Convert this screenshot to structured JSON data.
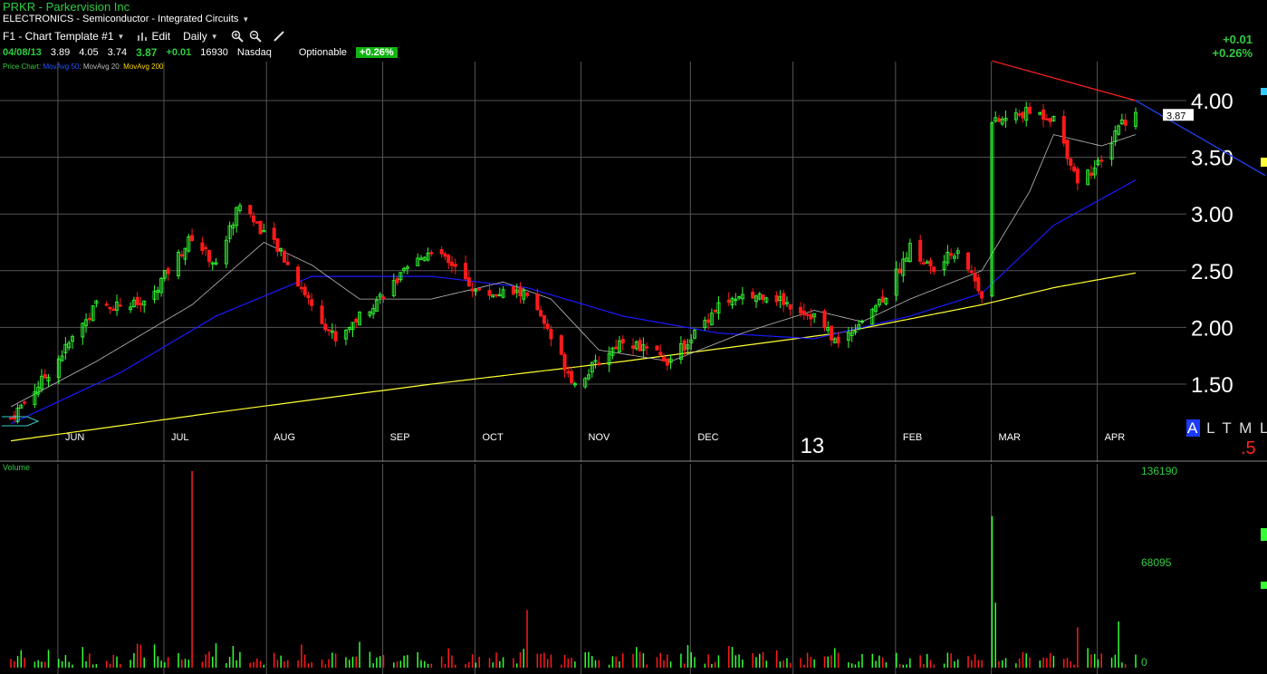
{
  "header": {
    "title": "PRKR - Parkervision Inc",
    "sector": "ELECTRONICS - Semiconductor - Integrated Circuits"
  },
  "toolbar": {
    "template": "F1 - Chart Template #1",
    "edit": "Edit",
    "period": "Daily"
  },
  "quote": {
    "date": "04/08/13",
    "open": "3.89",
    "high": "4.05",
    "low": "3.74",
    "last": "3.87",
    "change": "+0.01",
    "volume": "16930",
    "exchange": "Nasdaq",
    "optionable": "Optionable",
    "pct_change": "+0.26%"
  },
  "legend": {
    "price_chart": "Price Chart",
    "ma50": "MovAvg 50",
    "ma20": "MovAvg 20",
    "ma200": "MovAvg 200",
    "sep": ":"
  },
  "top_right": {
    "change": "+0.01",
    "pct": "+0.26%"
  },
  "watermark": {
    "letters_a": "A",
    "letters_rest": "L T M L",
    "red": ".5"
  },
  "colors": {
    "up": "#33ff33",
    "down": "#ff1a1a",
    "ma50": "#1a1aff",
    "ma20": "#bbbbbb",
    "ma200": "#ffff33",
    "trend": "#ff2222",
    "grid": "#555555"
  },
  "chart_data": [
    {
      "type": "candlestick",
      "title": "PRKR - Parkervision Inc",
      "x_start": "2012-05-14",
      "x_end": "2013-04-08",
      "month_labels": [
        "JUN",
        "JUL",
        "AUG",
        "SEP",
        "OCT",
        "NOV",
        "DEC",
        "13",
        "FEB",
        "MAR",
        "APR"
      ],
      "y_ticks": [
        "1.50",
        "2.00",
        "2.50",
        "3.00",
        "3.50",
        "4.00"
      ],
      "ylim": [
        1.15,
        4.4
      ],
      "last_price_label": "3.87",
      "close_anchors": [
        [
          "2012-05-14",
          1.2
        ],
        [
          "2012-05-25",
          1.6
        ],
        [
          "2012-06-08",
          2.2
        ],
        [
          "2012-06-22",
          2.2
        ],
        [
          "2012-07-06",
          2.8
        ],
        [
          "2012-07-13",
          2.55
        ],
        [
          "2012-07-20",
          3.1
        ],
        [
          "2012-08-01",
          2.65
        ],
        [
          "2012-08-10",
          2.2
        ],
        [
          "2012-08-17",
          1.9
        ],
        [
          "2012-08-31",
          2.3
        ],
        [
          "2012-09-14",
          2.7
        ],
        [
          "2012-09-28",
          2.3
        ],
        [
          "2012-10-12",
          2.3
        ],
        [
          "2012-10-26",
          1.5
        ],
        [
          "2012-11-09",
          1.9
        ],
        [
          "2012-11-23",
          1.7
        ],
        [
          "2012-12-07",
          2.2
        ],
        [
          "2012-12-21",
          2.3
        ],
        [
          "2013-01-04",
          2.1
        ],
        [
          "2013-01-11",
          1.85
        ],
        [
          "2013-01-25",
          2.3
        ],
        [
          "2013-02-01",
          2.7
        ],
        [
          "2013-02-08",
          2.5
        ],
        [
          "2013-02-15",
          2.7
        ],
        [
          "2013-02-22",
          2.3
        ],
        [
          "2013-02-25",
          3.8
        ],
        [
          "2013-03-08",
          3.9
        ],
        [
          "2013-03-15",
          3.85
        ],
        [
          "2013-03-22",
          3.3
        ],
        [
          "2013-03-29",
          3.45
        ],
        [
          "2013-04-03",
          3.8
        ],
        [
          "2013-04-08",
          3.87
        ]
      ],
      "ma20_anchors": [
        [
          "2012-05-14",
          1.3
        ],
        [
          "2012-06-08",
          1.7
        ],
        [
          "2012-07-06",
          2.2
        ],
        [
          "2012-07-27",
          2.75
        ],
        [
          "2012-08-10",
          2.55
        ],
        [
          "2012-08-24",
          2.25
        ],
        [
          "2012-09-14",
          2.25
        ],
        [
          "2012-10-05",
          2.4
        ],
        [
          "2012-10-19",
          2.25
        ],
        [
          "2012-11-02",
          1.8
        ],
        [
          "2012-11-23",
          1.7
        ],
        [
          "2012-12-14",
          1.95
        ],
        [
          "2013-01-04",
          2.15
        ],
        [
          "2013-01-18",
          2.05
        ],
        [
          "2013-02-01",
          2.25
        ],
        [
          "2013-02-22",
          2.5
        ],
        [
          "2013-03-08",
          3.2
        ],
        [
          "2013-03-15",
          3.7
        ],
        [
          "2013-03-29",
          3.6
        ],
        [
          "2013-04-08",
          3.7
        ]
      ],
      "ma50_anchors": [
        [
          "2012-05-14",
          1.15
        ],
        [
          "2012-06-15",
          1.6
        ],
        [
          "2012-07-13",
          2.1
        ],
        [
          "2012-08-10",
          2.45
        ],
        [
          "2012-09-14",
          2.45
        ],
        [
          "2012-10-12",
          2.35
        ],
        [
          "2012-11-09",
          2.1
        ],
        [
          "2012-12-07",
          1.95
        ],
        [
          "2013-01-04",
          1.9
        ],
        [
          "2013-02-01",
          2.1
        ],
        [
          "2013-02-22",
          2.3
        ],
        [
          "2013-03-15",
          2.9
        ],
        [
          "2013-04-08",
          3.3
        ]
      ],
      "ma200_anchors": [
        [
          "2012-05-14",
          1.0
        ],
        [
          "2012-07-13",
          1.25
        ],
        [
          "2012-09-14",
          1.5
        ],
        [
          "2012-11-09",
          1.7
        ],
        [
          "2013-01-11",
          1.95
        ],
        [
          "2013-02-22",
          2.2
        ],
        [
          "2013-03-15",
          2.35
        ],
        [
          "2013-04-08",
          2.48
        ]
      ],
      "trendline": [
        [
          "2013-02-25",
          4.35
        ],
        [
          "2013-04-08",
          4.0
        ]
      ],
      "trendline_right": [
        [
          "2013-04-08",
          4.0
        ],
        [
          "2013-04-22",
          3.7
        ]
      ],
      "grid": true
    },
    {
      "type": "bar",
      "title": "Volume",
      "y_ticks": [
        "0",
        "68095",
        "136190"
      ],
      "ylim": [
        0,
        136190
      ],
      "notable": [
        [
          "2012-07-06",
          136190
        ],
        [
          "2013-02-25",
          105000
        ],
        [
          "2013-02-26",
          45000
        ],
        [
          "2012-10-12",
          40000
        ],
        [
          "2013-03-22",
          28000
        ],
        [
          "2013-04-03",
          32000
        ]
      ]
    }
  ]
}
